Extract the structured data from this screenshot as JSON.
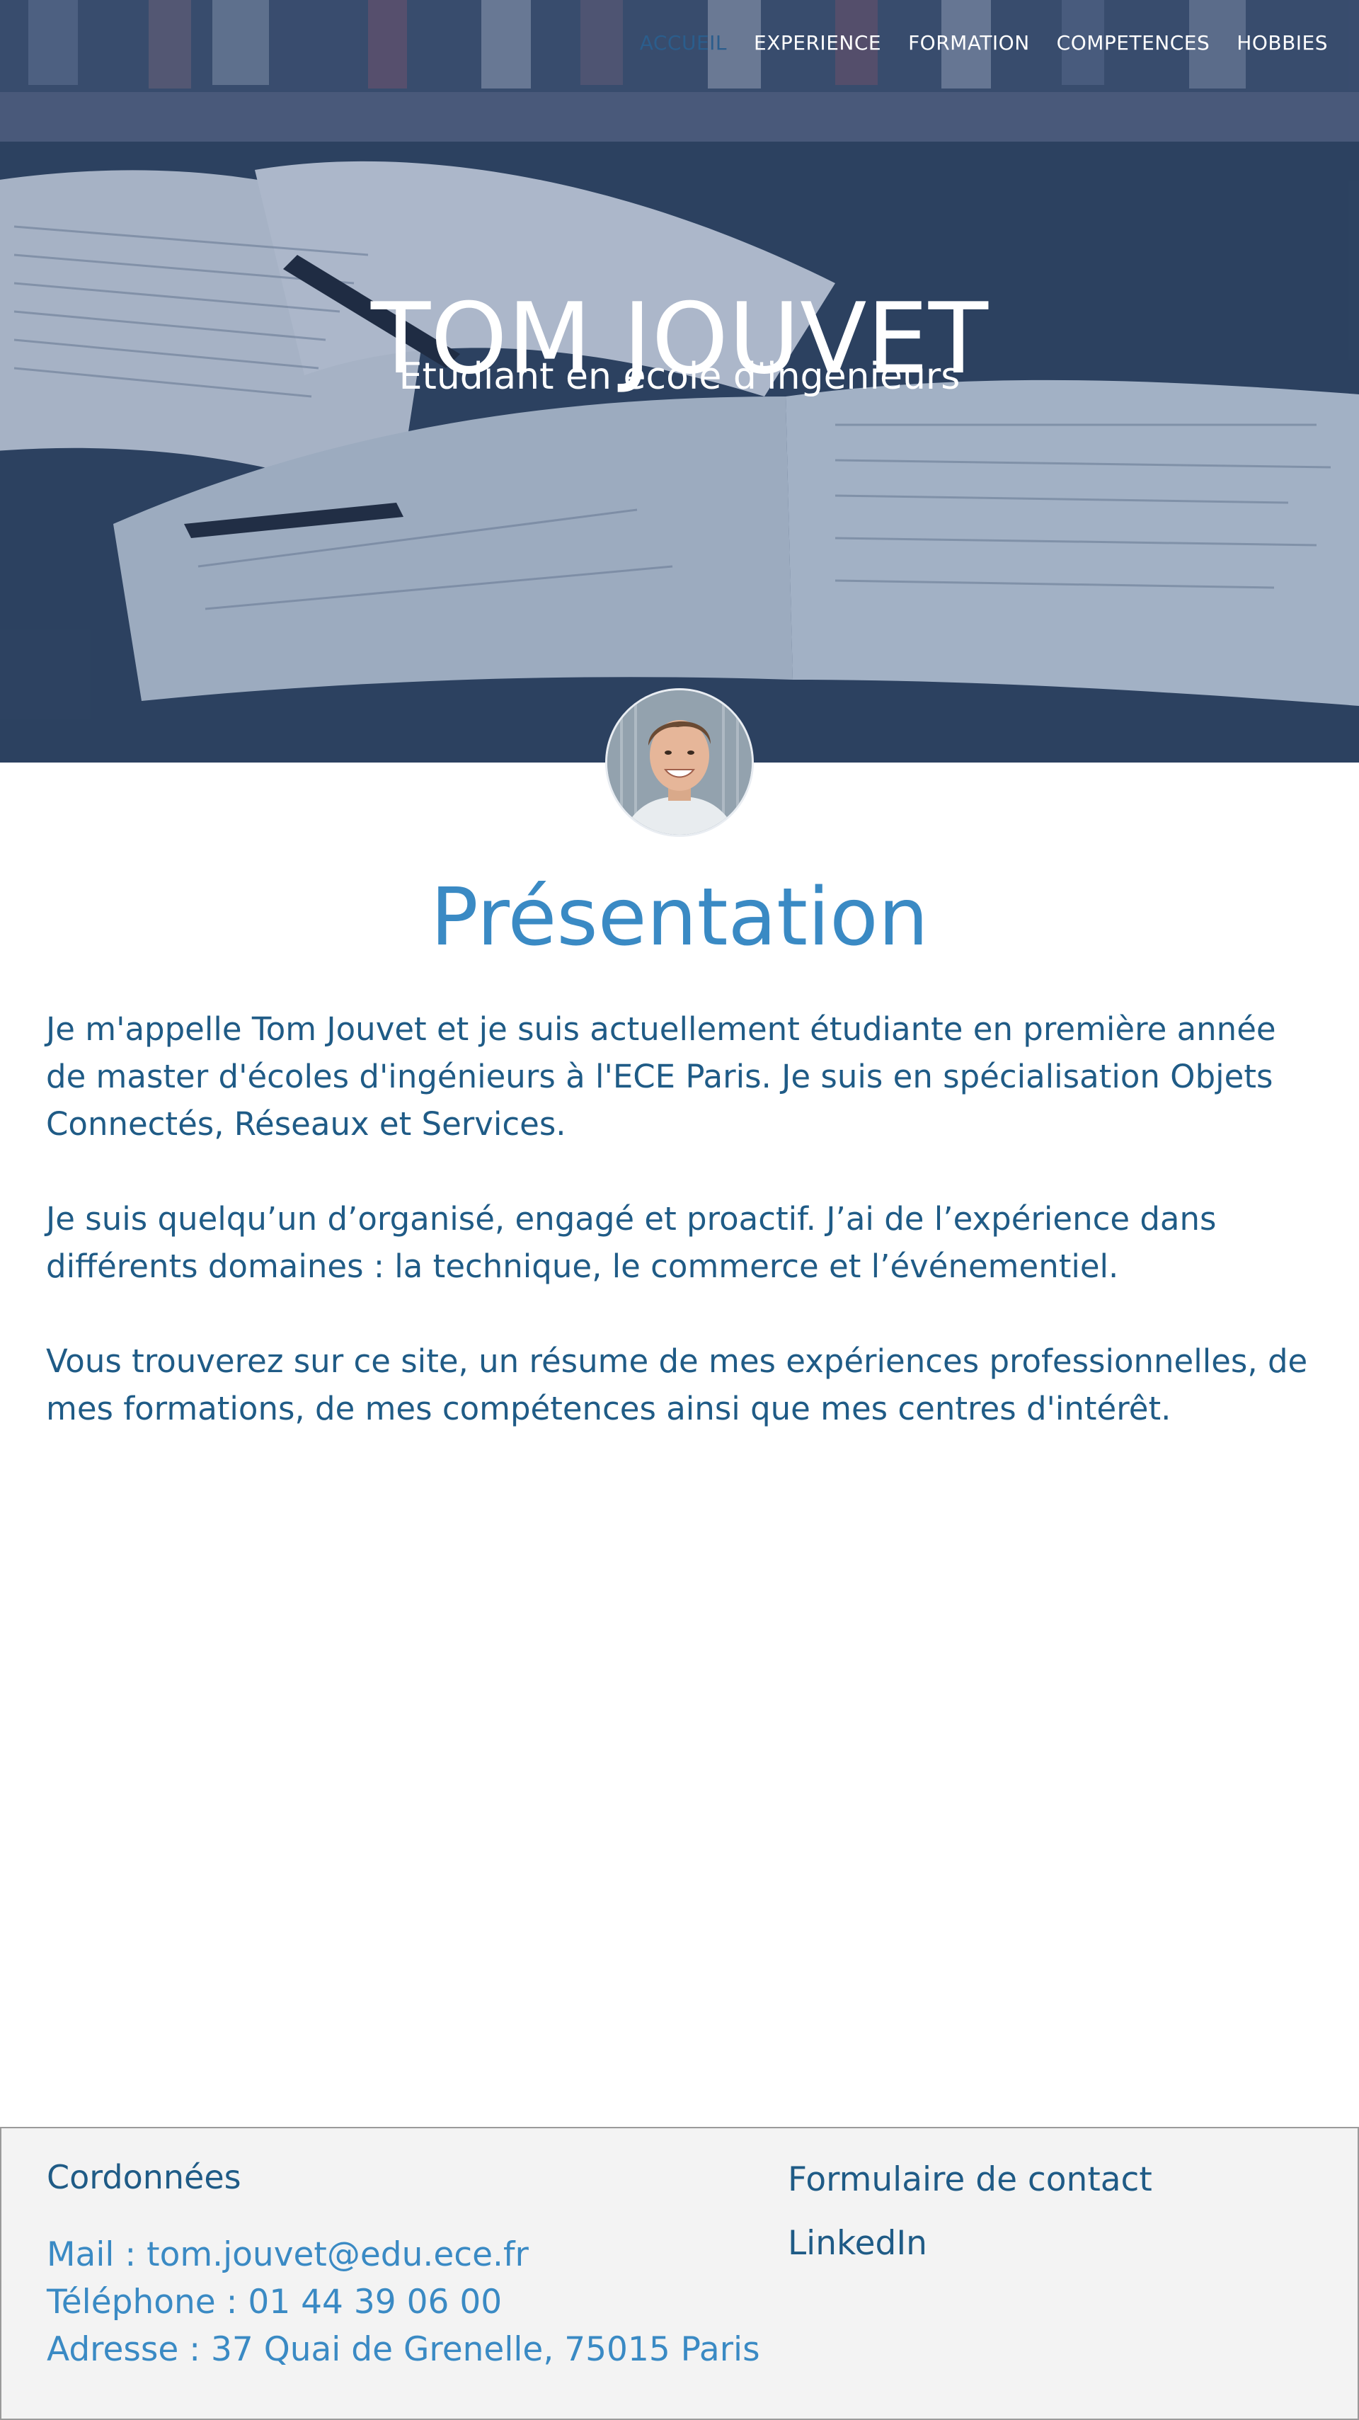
{
  "nav": {
    "items": [
      {
        "label": "ACCUEIL",
        "active": true
      },
      {
        "label": "EXPERIENCE",
        "active": false
      },
      {
        "label": "FORMATION",
        "active": false
      },
      {
        "label": "COMPETENCES",
        "active": false
      },
      {
        "label": "HOBBIES",
        "active": false
      }
    ]
  },
  "hero": {
    "title": "TOM JOUVET",
    "subtitle": "Etudiant en école d'ingénieurs"
  },
  "presentation": {
    "title": "Présentation",
    "paragraphs": [
      "Je m'appelle Tom Jouvet et je suis actuellement étudiante en première année de master d'écoles d'ingénieurs à l'ECE Paris. Je suis en spécialisation Objets Connectés, Réseaux et Services.",
      "Je suis quelqu’un d’organisé, engagé et proactif. J’ai de l’expérience dans différents domaines : la technique, le commerce et l’événementiel.",
      "Vous trouverez sur ce site, un résume de mes expériences professionnelles, de mes formations, de mes compétences ainsi que mes centres d'intérêt."
    ]
  },
  "footer": {
    "heading": "Cordonnées",
    "mail": "Mail : tom.jouvet@edu.ece.fr",
    "phone": "Téléphone : 01 44 39 06 00",
    "address": "Adresse : 37 Quai de Grenelle, 75015 Paris",
    "links": [
      "Formulaire de contact",
      "LinkedIn"
    ]
  },
  "colors": {
    "accent": "#3a8ac4",
    "text": "#1f5b86",
    "nav_active": "#2b5d8c",
    "footer_bg": "#f3f3f3"
  },
  "icons": {
    "avatar": "profile-photo"
  }
}
